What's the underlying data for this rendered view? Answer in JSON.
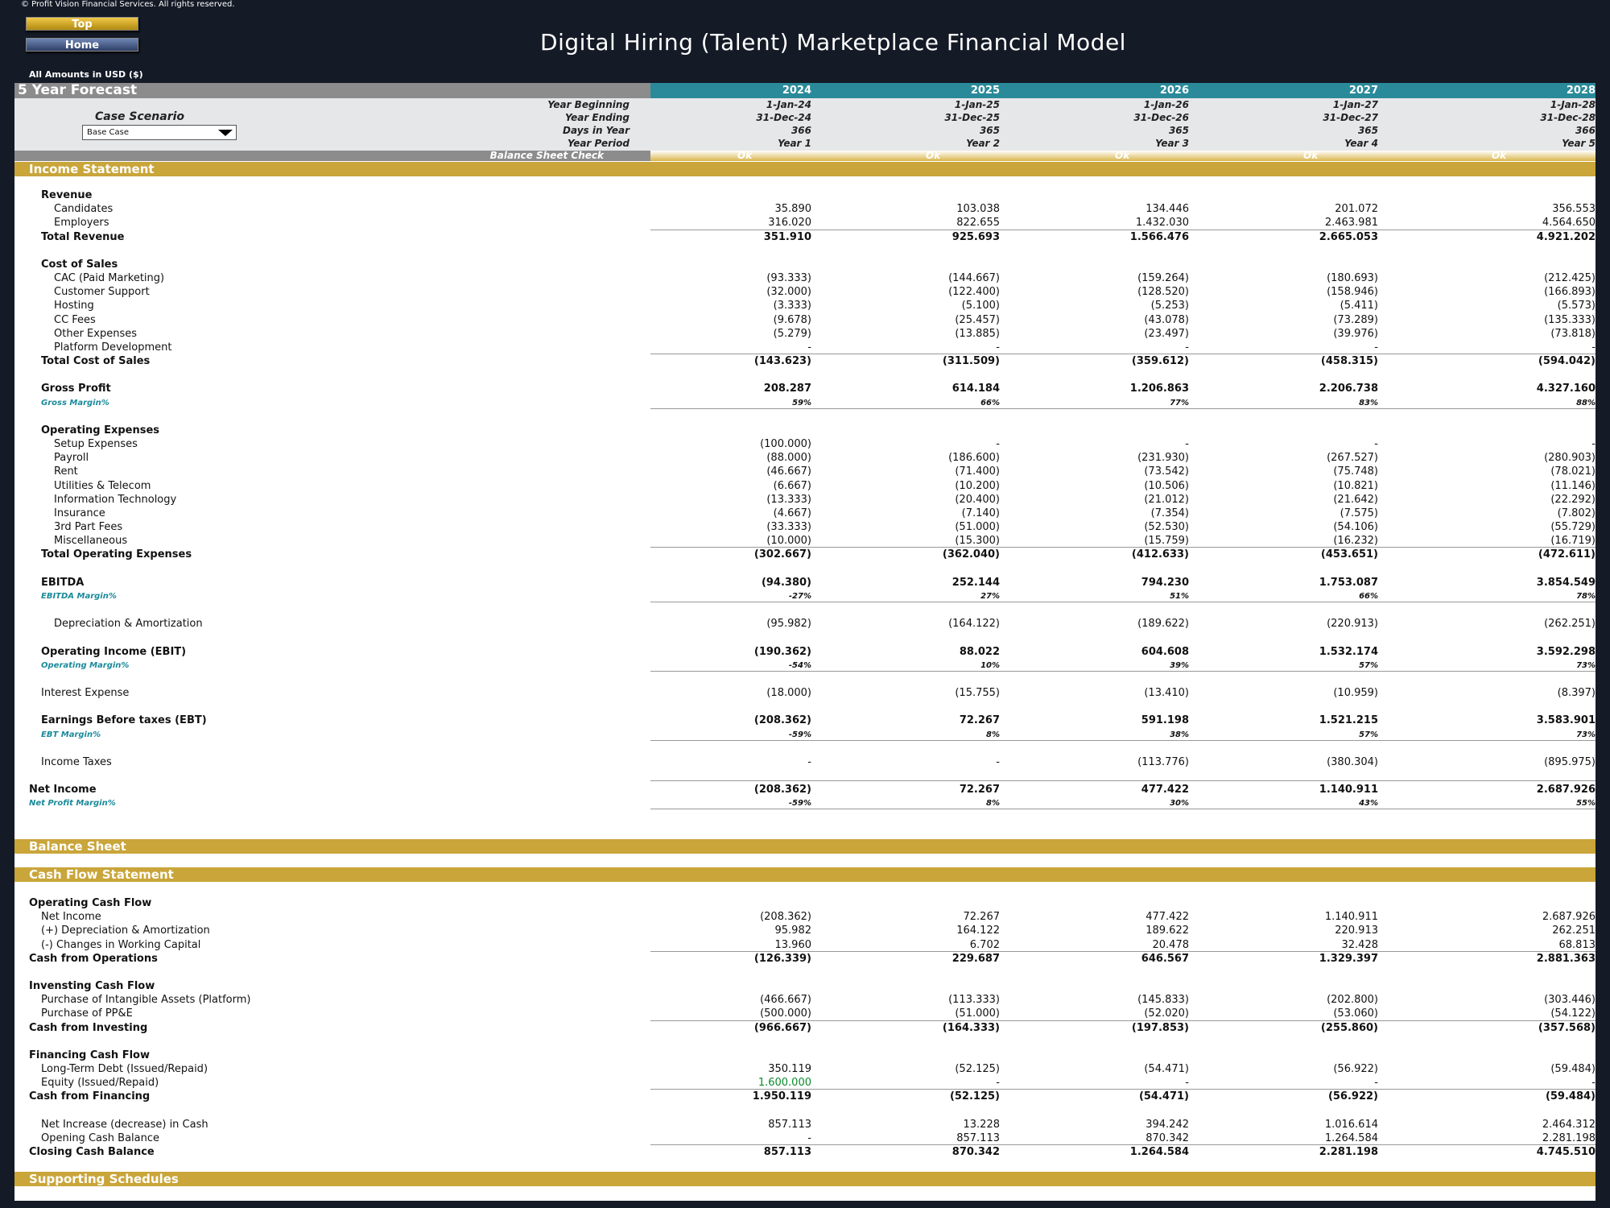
{
  "copyright": "© Profit Vision Financial Services. All rights reserved.",
  "nav": {
    "top": "Top",
    "home": "Home"
  },
  "title": "Digital Hiring (Talent) Marketplace Financial Model",
  "amounts_note": "All Amounts in  USD ($)",
  "forecast_title": "5 Year Forecast",
  "years": [
    "2024",
    "2025",
    "2026",
    "2027",
    "2028"
  ],
  "header_rows": [
    {
      "label": "Year Beginning",
      "values": [
        "1-Jan-24",
        "1-Jan-25",
        "1-Jan-26",
        "1-Jan-27",
        "1-Jan-28"
      ]
    },
    {
      "label": "Year Ending",
      "values": [
        "31-Dec-24",
        "31-Dec-25",
        "31-Dec-26",
        "31-Dec-27",
        "31-Dec-28"
      ]
    },
    {
      "label": "Days in Year",
      "values": [
        "366",
        "365",
        "365",
        "365",
        "366"
      ]
    },
    {
      "label": "Year Period",
      "values": [
        "Year 1",
        "Year 2",
        "Year 3",
        "Year 4",
        "Year 5"
      ]
    }
  ],
  "case_scenario": {
    "label": "Case Scenario",
    "value": "Base Case"
  },
  "balance_check": {
    "label": "Balance Sheet Check",
    "values": [
      "Ok",
      "Ok",
      "Ok",
      "Ok",
      "Ok"
    ]
  },
  "sections": {
    "income": "Income Statement",
    "balance": "Balance Sheet",
    "cashflow": "Cash Flow Statement",
    "supporting": "Supporting Schedules"
  },
  "income_rows": [
    {
      "label": "Revenue",
      "indent": 2,
      "bold": true,
      "values": []
    },
    {
      "label": "Candidates",
      "indent": 3,
      "values": [
        "35.890",
        "103.038",
        "134.446",
        "201.072",
        "356.553"
      ]
    },
    {
      "label": "Employers",
      "indent": 3,
      "values": [
        "316.020",
        "822.655",
        "1.432.030",
        "2.463.981",
        "4.564.650"
      ]
    },
    {
      "label": "Total Revenue",
      "indent": 2,
      "bold": true,
      "line": true,
      "values": [
        "351.910",
        "925.693",
        "1.566.476",
        "2.665.053",
        "4.921.202"
      ]
    },
    {
      "blank": true
    },
    {
      "label": "Cost of Sales",
      "indent": 2,
      "bold": true,
      "values": []
    },
    {
      "label": "CAC (Paid Marketing)",
      "indent": 3,
      "values": [
        "(93.333)",
        "(144.667)",
        "(159.264)",
        "(180.693)",
        "(212.425)"
      ]
    },
    {
      "label": "Customer Support",
      "indent": 3,
      "values": [
        "(32.000)",
        "(122.400)",
        "(128.520)",
        "(158.946)",
        "(166.893)"
      ]
    },
    {
      "label": "Hosting",
      "indent": 3,
      "values": [
        "(3.333)",
        "(5.100)",
        "(5.253)",
        "(5.411)",
        "(5.573)"
      ]
    },
    {
      "label": "CC Fees",
      "indent": 3,
      "values": [
        "(9.678)",
        "(25.457)",
        "(43.078)",
        "(73.289)",
        "(135.333)"
      ]
    },
    {
      "label": "Other Expenses",
      "indent": 3,
      "values": [
        "(5.279)",
        "(13.885)",
        "(23.497)",
        "(39.976)",
        "(73.818)"
      ]
    },
    {
      "label": "Platform Development",
      "indent": 3,
      "values": [
        "-",
        "-",
        "-",
        "-",
        "-"
      ]
    },
    {
      "label": "Total Cost of Sales",
      "indent": 2,
      "bold": true,
      "line": true,
      "values": [
        "(143.623)",
        "(311.509)",
        "(359.612)",
        "(458.315)",
        "(594.042)"
      ]
    },
    {
      "blank": true
    },
    {
      "label": "Gross Profit",
      "indent": 2,
      "bold": true,
      "values": [
        "208.287",
        "614.184",
        "1.206.863",
        "2.206.738",
        "4.327.160"
      ]
    },
    {
      "label": "Gross Margin%",
      "indent": 2,
      "margin": true,
      "line": true,
      "values": [
        "59%",
        "66%",
        "77%",
        "83%",
        "88%"
      ]
    },
    {
      "blank": true
    },
    {
      "label": "Operating Expenses",
      "indent": 2,
      "bold": true,
      "values": []
    },
    {
      "label": "Setup Expenses",
      "indent": 3,
      "values": [
        "(100.000)",
        "-",
        "-",
        "-",
        "-"
      ]
    },
    {
      "label": "Payroll",
      "indent": 3,
      "values": [
        "(88.000)",
        "(186.600)",
        "(231.930)",
        "(267.527)",
        "(280.903)"
      ]
    },
    {
      "label": "Rent",
      "indent": 3,
      "values": [
        "(46.667)",
        "(71.400)",
        "(73.542)",
        "(75.748)",
        "(78.021)"
      ]
    },
    {
      "label": "Utilities & Telecom",
      "indent": 3,
      "values": [
        "(6.667)",
        "(10.200)",
        "(10.506)",
        "(10.821)",
        "(11.146)"
      ]
    },
    {
      "label": "Information Technology",
      "indent": 3,
      "values": [
        "(13.333)",
        "(20.400)",
        "(21.012)",
        "(21.642)",
        "(22.292)"
      ]
    },
    {
      "label": "Insurance",
      "indent": 3,
      "values": [
        "(4.667)",
        "(7.140)",
        "(7.354)",
        "(7.575)",
        "(7.802)"
      ]
    },
    {
      "label": "3rd Part Fees",
      "indent": 3,
      "values": [
        "(33.333)",
        "(51.000)",
        "(52.530)",
        "(54.106)",
        "(55.729)"
      ]
    },
    {
      "label": "Miscellaneous",
      "indent": 3,
      "values": [
        "(10.000)",
        "(15.300)",
        "(15.759)",
        "(16.232)",
        "(16.719)"
      ]
    },
    {
      "label": "Total Operating Expenses",
      "indent": 2,
      "bold": true,
      "line": true,
      "values": [
        "(302.667)",
        "(362.040)",
        "(412.633)",
        "(453.651)",
        "(472.611)"
      ]
    },
    {
      "blank": true
    },
    {
      "label": "EBITDA",
      "indent": 2,
      "bold": true,
      "values": [
        "(94.380)",
        "252.144",
        "794.230",
        "1.753.087",
        "3.854.549"
      ]
    },
    {
      "label": "EBITDA Margin%",
      "indent": 2,
      "margin": true,
      "line": true,
      "values": [
        "-27%",
        "27%",
        "51%",
        "66%",
        "78%"
      ]
    },
    {
      "blank": true
    },
    {
      "label": "Depreciation & Amortization",
      "indent": 3,
      "values": [
        "(95.982)",
        "(164.122)",
        "(189.622)",
        "(220.913)",
        "(262.251)"
      ]
    },
    {
      "blank": true
    },
    {
      "label": "Operating Income (EBIT)",
      "indent": 2,
      "bold": true,
      "values": [
        "(190.362)",
        "88.022",
        "604.608",
        "1.532.174",
        "3.592.298"
      ]
    },
    {
      "label": "Operating Margin%",
      "indent": 2,
      "margin": true,
      "line": true,
      "values": [
        "-54%",
        "10%",
        "39%",
        "57%",
        "73%"
      ]
    },
    {
      "blank": true
    },
    {
      "label": "Interest Expense",
      "indent": 2,
      "values": [
        "(18.000)",
        "(15.755)",
        "(13.410)",
        "(10.959)",
        "(8.397)"
      ]
    },
    {
      "blank": true
    },
    {
      "label": "Earnings Before taxes (EBT)",
      "indent": 2,
      "bold": true,
      "values": [
        "(208.362)",
        "72.267",
        "591.198",
        "1.521.215",
        "3.583.901"
      ]
    },
    {
      "label": "EBT Margin%",
      "indent": 2,
      "margin": true,
      "line": true,
      "values": [
        "-59%",
        "8%",
        "38%",
        "57%",
        "73%"
      ]
    },
    {
      "blank": true
    },
    {
      "label": "Income Taxes",
      "indent": 2,
      "values": [
        "-",
        "-",
        "(113.776)",
        "(380.304)",
        "(895.975)"
      ]
    },
    {
      "blank": true
    },
    {
      "label": "Net Income",
      "indent": 1,
      "bold": true,
      "topline": true,
      "values": [
        "(208.362)",
        "72.267",
        "477.422",
        "1.140.911",
        "2.687.926"
      ]
    },
    {
      "label": "Net Profit Margin%",
      "indent": 1,
      "margin": true,
      "line": true,
      "values": [
        "-59%",
        "8%",
        "30%",
        "43%",
        "55%"
      ]
    }
  ],
  "cashflow_rows": [
    {
      "label": "Operating Cash Flow",
      "indent": 1,
      "bold": true,
      "values": []
    },
    {
      "label": "Net Income",
      "indent": 2,
      "values": [
        "(208.362)",
        "72.267",
        "477.422",
        "1.140.911",
        "2.687.926"
      ]
    },
    {
      "label": "(+) Depreciation & Amortization",
      "indent": 2,
      "values": [
        "95.982",
        "164.122",
        "189.622",
        "220.913",
        "262.251"
      ]
    },
    {
      "label": "(-) Changes in Working Capital",
      "indent": 2,
      "values": [
        "13.960",
        "6.702",
        "20.478",
        "32.428",
        "68.813"
      ]
    },
    {
      "label": "Cash from Operations",
      "indent": 1,
      "bold": true,
      "line": true,
      "values": [
        "(126.339)",
        "229.687",
        "646.567",
        "1.329.397",
        "2.881.363"
      ]
    },
    {
      "blank": true
    },
    {
      "label": "Invensting Cash Flow",
      "indent": 1,
      "bold": true,
      "values": []
    },
    {
      "label": "Purchase of Intangible Assets (Platform)",
      "indent": 2,
      "values": [
        "(466.667)",
        "(113.333)",
        "(145.833)",
        "(202.800)",
        "(303.446)"
      ]
    },
    {
      "label": "Purchase of PP&E",
      "indent": 2,
      "values": [
        "(500.000)",
        "(51.000)",
        "(52.020)",
        "(53.060)",
        "(54.122)"
      ]
    },
    {
      "label": "Cash from Investing",
      "indent": 1,
      "bold": true,
      "line": true,
      "values": [
        "(966.667)",
        "(164.333)",
        "(197.853)",
        "(255.860)",
        "(357.568)"
      ]
    },
    {
      "blank": true
    },
    {
      "label": "Financing Cash Flow",
      "indent": 1,
      "bold": true,
      "values": []
    },
    {
      "label": "Long-Term Debt (Issued/Repaid)",
      "indent": 2,
      "values": [
        "350.119",
        "(52.125)",
        "(54.471)",
        "(56.922)",
        "(59.484)"
      ]
    },
    {
      "label": "Equity (Issued/Repaid)",
      "indent": 2,
      "green_first": true,
      "values": [
        "1.600.000",
        "-",
        "-",
        "-",
        "-"
      ]
    },
    {
      "label": "Cash from Financing",
      "indent": 1,
      "bold": true,
      "line": true,
      "values": [
        "1.950.119",
        "(52.125)",
        "(54.471)",
        "(56.922)",
        "(59.484)"
      ]
    },
    {
      "blank": true
    },
    {
      "label": "Net Increase (decrease) in Cash",
      "indent": 2,
      "values": [
        "857.113",
        "13.228",
        "394.242",
        "1.016.614",
        "2.464.312"
      ]
    },
    {
      "label": "Opening Cash Balance",
      "indent": 2,
      "values": [
        "-",
        "857.113",
        "870.342",
        "1.264.584",
        "2.281.198"
      ]
    },
    {
      "label": "Closing Cash Balance",
      "indent": 1,
      "bold": true,
      "line": true,
      "values": [
        "857.113",
        "870.342",
        "1.264.584",
        "2.281.198",
        "4.745.510"
      ]
    }
  ]
}
